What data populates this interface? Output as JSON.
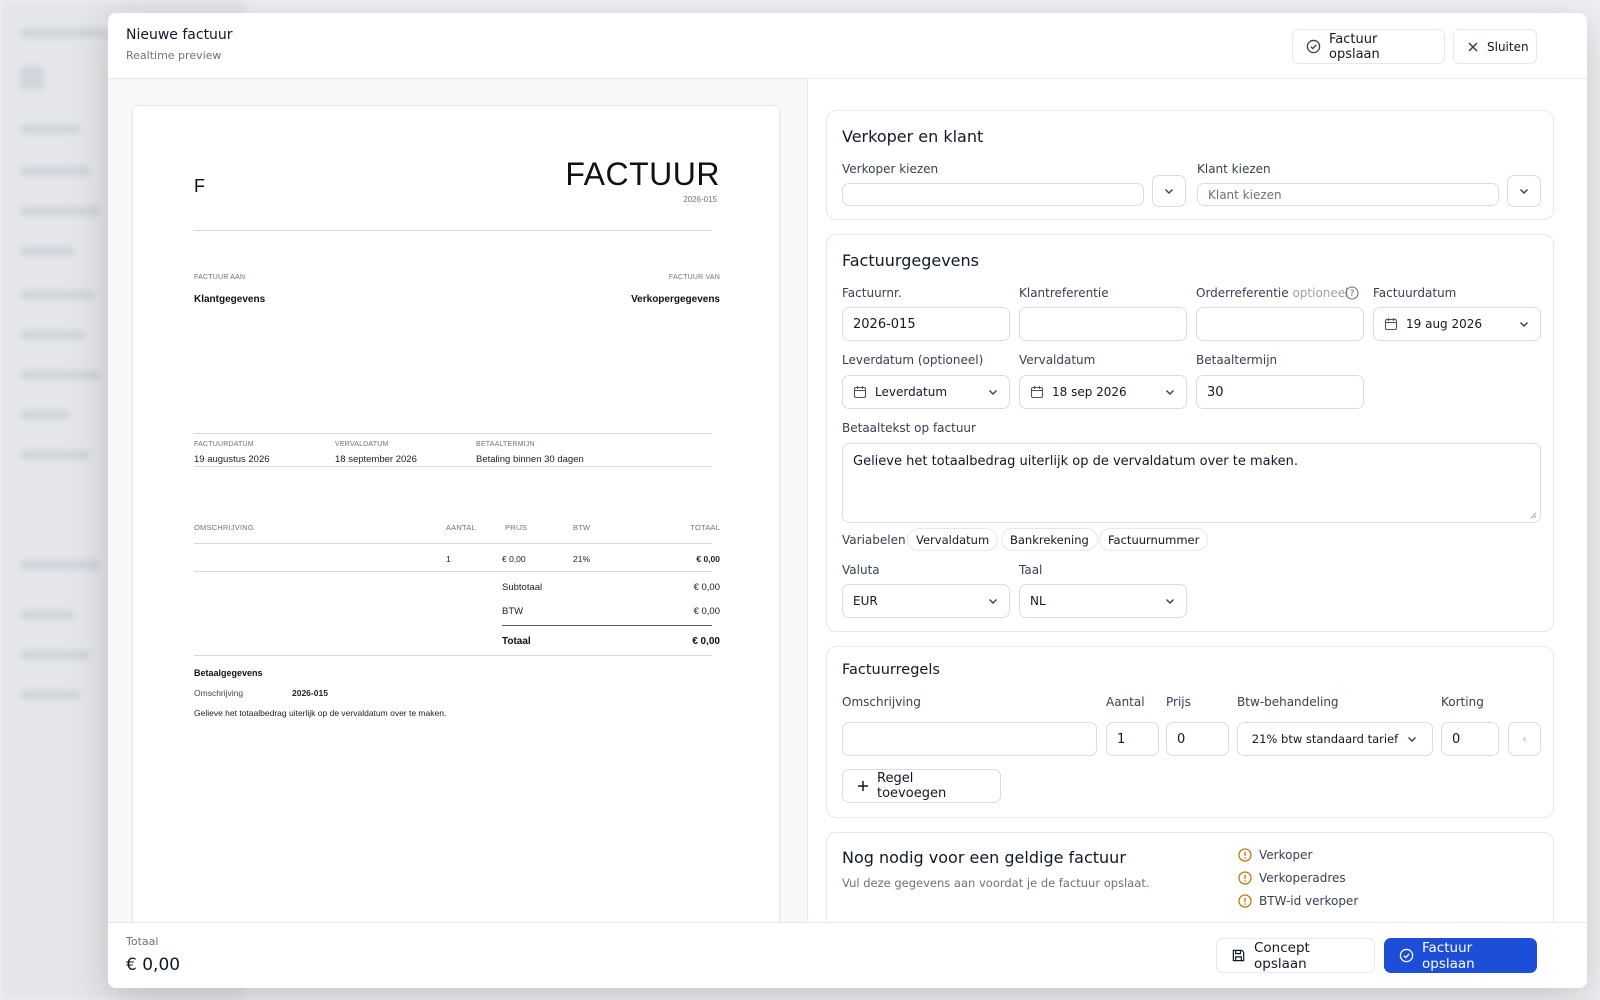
{
  "modal": {
    "title": "Nieuwe factuur",
    "subtitle": "Realtime preview",
    "save_label": "Factuur opslaan",
    "close_label": "Sluiten"
  },
  "preview": {
    "logo_letter": "F",
    "doc_title": "FACTUUR",
    "invoice_number": "2026-015",
    "to_label": "FACTUUR AAN",
    "to_value": "Klantgegevens",
    "from_label": "FACTUUR VAN",
    "from_value": "Verkopergegevens",
    "meta": [
      {
        "label": "FACTUURDATUM",
        "value": "19 augustus 2026"
      },
      {
        "label": "VERVALDATUM",
        "value": "18 september 2026"
      },
      {
        "label": "BETAALTERMIJN",
        "value": "Betaling binnen 30 dagen"
      }
    ],
    "table_headers": {
      "desc": "OMSCHRIJVING",
      "qty": "AANTAL",
      "price": "PRIJS",
      "vat": "BTW",
      "total": "TOTAAL"
    },
    "row": {
      "qty": "1",
      "price": "€ 0,00",
      "vat": "21%",
      "total": "€ 0,00"
    },
    "subtotal_label": "Subtotaal",
    "subtotal_value": "€ 0,00",
    "vat_label": "BTW",
    "vat_value": "€ 0,00",
    "total_label": "Totaal",
    "total_value": "€ 0,00",
    "payment_title": "Betaalgegevens",
    "payment_desc_label": "Omschrijving",
    "payment_desc_value": "2026-015",
    "payment_text": "Gelieve het totaalbedrag uiterlijk op de vervaldatum over te maken."
  },
  "seller_client": {
    "title": "Verkoper en klant",
    "seller_label": "Verkoper kiezen",
    "seller_value": "",
    "client_label": "Klant kiezen",
    "client_placeholder": "Klant kiezen"
  },
  "details": {
    "title": "Factuurgegevens",
    "invoice_nr_label": "Factuurnr.",
    "invoice_nr_value": "2026-015",
    "client_ref_label": "Klantreferentie",
    "client_ref_value": "",
    "order_ref_label": "Orderreferentie",
    "order_ref_optional": "optioneel",
    "order_ref_value": "",
    "invoice_date_label": "Factuurdatum",
    "invoice_date_value": "19 aug 2026",
    "delivery_label": "Leverdatum (optioneel)",
    "delivery_value": "Leverdatum",
    "due_label": "Vervaldatum",
    "due_value": "18 sep 2026",
    "term_label": "Betaaltermijn",
    "term_value": "30",
    "paytext_label": "Betaaltekst op factuur",
    "paytext_value": "Gelieve het totaalbedrag uiterlijk op de vervaldatum over te maken.",
    "variables_label": "Variabelen",
    "variables": [
      "Vervaldatum",
      "Bankrekening",
      "Factuurnummer"
    ],
    "currency_label": "Valuta",
    "currency_value": "EUR",
    "language_label": "Taal",
    "language_value": "NL"
  },
  "lines": {
    "title": "Factuurregels",
    "col_desc": "Omschrijving",
    "col_qty": "Aantal",
    "col_price": "Prijs",
    "col_vat": "Btw-behandeling",
    "col_discount": "Korting",
    "row_desc": "",
    "row_qty": "1",
    "row_price": "0",
    "row_vat": "21% btw standaard tarief",
    "row_discount": "0",
    "row_unit": "‹",
    "add_label": "Regel toevoegen"
  },
  "required": {
    "title": "Nog nodig voor een geldige factuur",
    "subtitle": "Vul deze gegevens aan voordat je de factuur opslaat.",
    "items": [
      "Verkoper",
      "Verkoperadres",
      "BTW-id verkoper"
    ]
  },
  "footer": {
    "total_label": "Totaal",
    "total_value": "€ 0,00",
    "draft_label": "Concept opslaan",
    "save_label": "Factuur opslaan"
  },
  "colors": {
    "primary": "#1d4ed8",
    "warning": "#c2780a"
  }
}
